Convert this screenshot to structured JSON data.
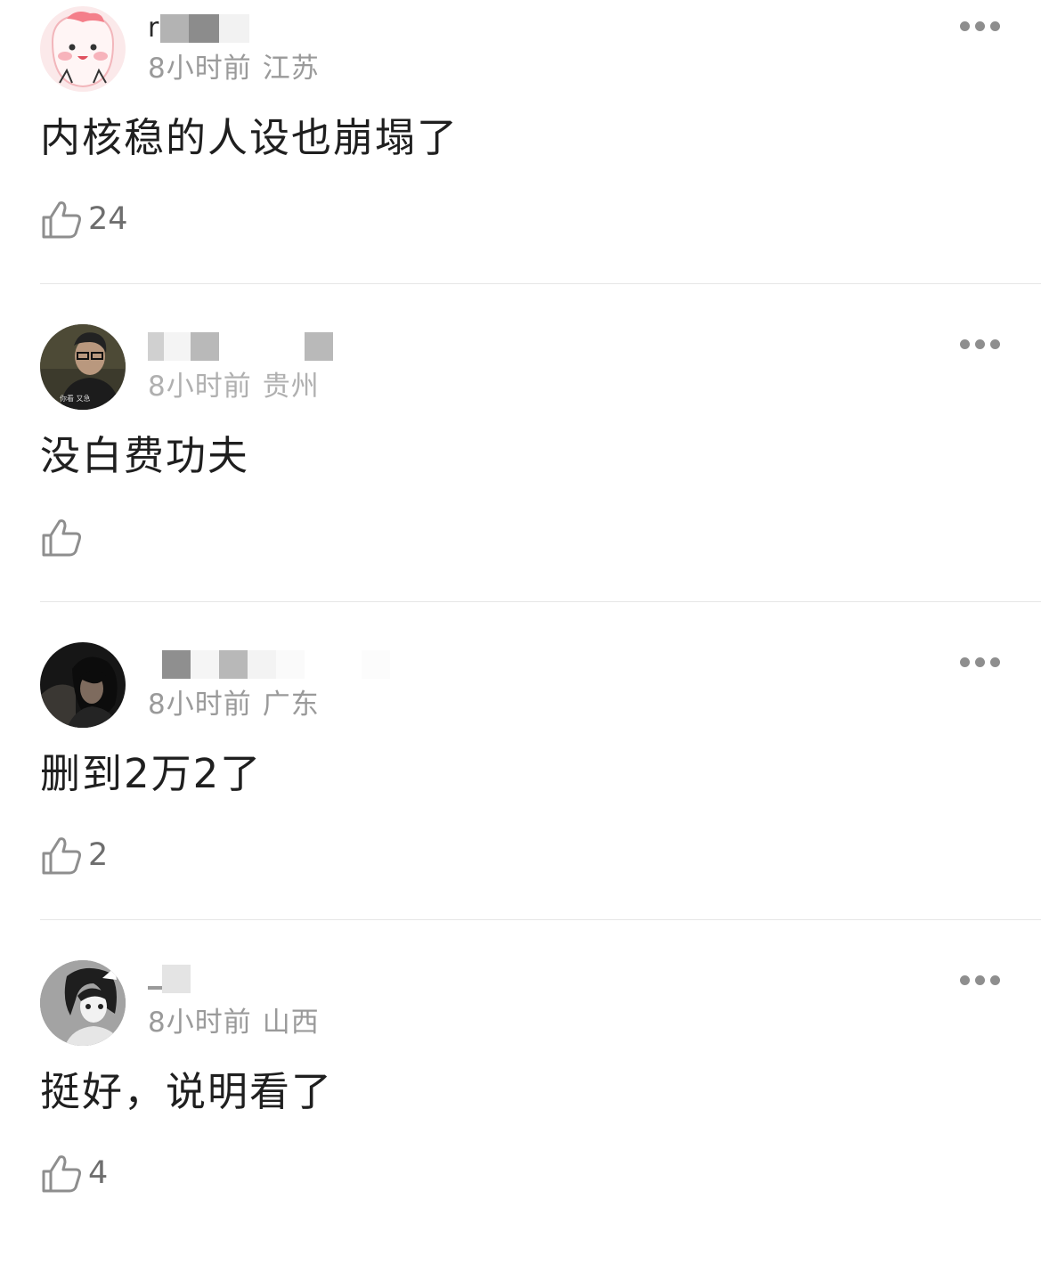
{
  "comments": [
    {
      "username_visible": "r",
      "time": "8小时前",
      "location": "江苏",
      "text": "内核稳的人设也崩塌了",
      "likes": "24",
      "avatar_icon": "cartoon-pink-avatar"
    },
    {
      "username_visible": "",
      "time": "8小时前",
      "location": "贵州",
      "text": "没白费功夫",
      "likes": "",
      "avatar_icon": "man-with-glasses-avatar"
    },
    {
      "username_visible": "",
      "time": "8小时前",
      "location": "广东",
      "text": "删到2万2了",
      "likes": "2",
      "avatar_icon": "woman-dark-photo-avatar"
    },
    {
      "username_visible": "",
      "time": "8小时前",
      "location": "山西",
      "text": "挺好，说明看了",
      "likes": "4",
      "avatar_icon": "anime-girl-avatar"
    }
  ],
  "icons": {
    "like": "thumbs-up-icon",
    "more": "more-dots-icon"
  },
  "colors": {
    "meta": "#9a9a9a",
    "text": "#1f1f1f",
    "divider": "#e6e6e6",
    "icon": "#8e8e8e"
  }
}
